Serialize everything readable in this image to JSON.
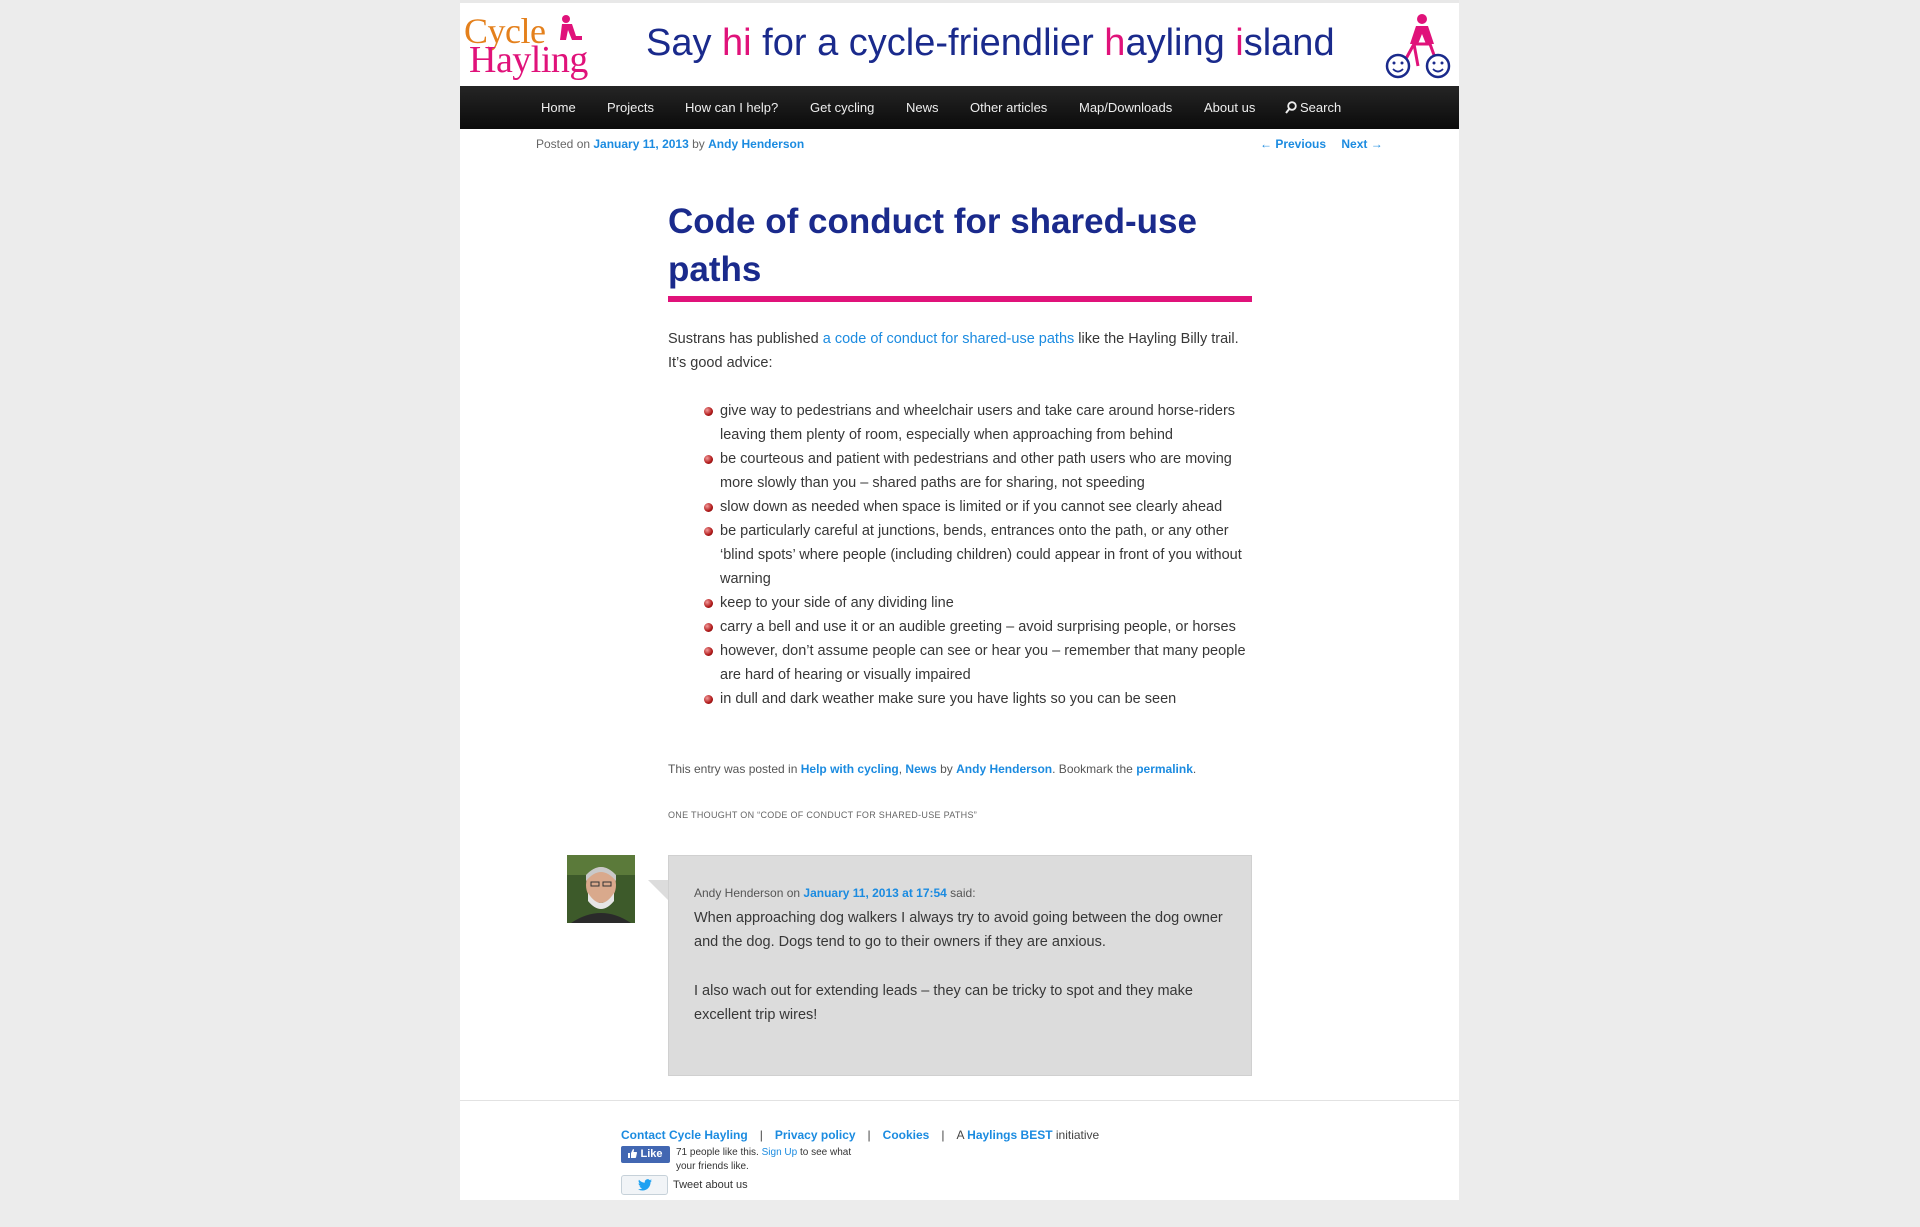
{
  "header": {
    "logo_line1": "Cycle",
    "logo_line2": "Hayling",
    "tagline_parts": [
      "Say ",
      "hi",
      " for a cycle-friendlier ",
      "h",
      "ayling ",
      "i",
      "sland"
    ],
    "colors": {
      "blue": "#1a2a8c",
      "pink": "#e0127a",
      "orange": "#e4801c"
    }
  },
  "nav": {
    "items": [
      "Home",
      "Projects",
      "How can I help?",
      "Get cycling",
      "News",
      "Other articles",
      "Map/Downloads",
      "About us"
    ],
    "search_label": "Search",
    "search_icon": "search-icon"
  },
  "post_meta": {
    "posted_on": "Posted on ",
    "date": "January 11, 2013",
    "by": " by ",
    "author": "Andy Henderson"
  },
  "post_nav": {
    "previous": "← Previous",
    "next": "Next →"
  },
  "article": {
    "title": "Code of conduct for shared-use paths",
    "intro_before": "Sustrans has published ",
    "intro_link": "a code of conduct for shared-use paths",
    "intro_after": " like the Hayling Billy trail.  It’s good advice:",
    "bullets": [
      "give way to pedestrians and wheelchair users and take care around horse-riders leaving them plenty of room, especially when approaching from behind",
      "be courteous and patient with pedestrians and other path users who are moving more slowly than you – shared paths are for sharing, not speeding",
      "slow down as needed when space is limited or if you cannot see clearly ahead",
      "be particularly careful at junctions, bends, entrances onto the path, or any other ‘blind spots’ where people (including children) could appear in front of you without warning",
      "keep to your side of any dividing line",
      "carry a bell and use it or an audible greeting – avoid surprising people, or horses",
      "however, don’t assume people can see or hear you – remember that many people are hard of hearing or visually impaired",
      "in dull and dark weather make sure you have lights so you can be seen"
    ],
    "footer": {
      "prefix": "This entry was posted in ",
      "cat1": "Help with cycling",
      "comma": ", ",
      "cat2": "News",
      "by": " by ",
      "author": "Andy Henderson",
      "bookmark": ". Bookmark the ",
      "permalink": "permalink",
      "end": "."
    }
  },
  "comments": {
    "heading": "ONE THOUGHT ON “CODE OF CONDUCT FOR SHARED-USE PATHS”",
    "items": [
      {
        "author": "Andy Henderson",
        "on": " on ",
        "date": "January 11, 2013 at 17:54",
        "said": " said:",
        "paragraphs": [
          "When approaching dog walkers I always try to avoid going between the dog owner and the dog. Dogs tend to go to their owners if they are anxious.",
          "I also wach out for extending leads – they can be tricky to spot and they make excellent trip wires!"
        ]
      }
    ]
  },
  "site_footer": {
    "contact": "Contact Cycle Hayling",
    "privacy": "Privacy policy",
    "cookies": "Cookies",
    "initiative_prefix": "A ",
    "initiative_link": "Haylings BEST",
    "initiative_suffix": " initiative",
    "fb_like": "Like",
    "fb_text_before": "71 people like this. ",
    "fb_signup": "Sign Up",
    "fb_text_after": " to see what your friends like.",
    "tweet": "Tweet about us",
    "colors": {
      "facebook": "#4267b2",
      "twitter": "#1da1f2"
    }
  }
}
